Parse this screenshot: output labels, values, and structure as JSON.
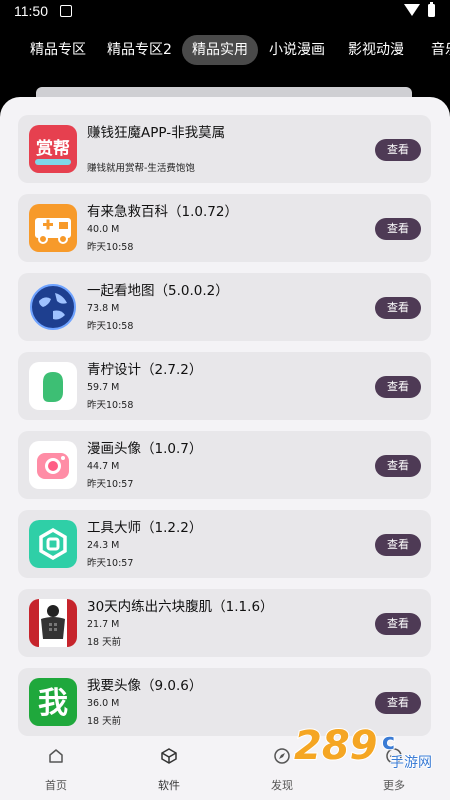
{
  "status_bar": {
    "time": "11:50"
  },
  "tabs": [
    "精品专区",
    "精品专区2",
    "精品实用",
    "小说漫画",
    "影视动漫",
    "音乐"
  ],
  "active_tab": 2,
  "apps": [
    {
      "name": "赚钱狂魔APP-非我莫属",
      "line1": "",
      "line2": "赚钱就用赏帮-生活费饱饱",
      "button": "查看",
      "icon": "shangbang-logo-icon"
    },
    {
      "name": "有来急救百科（1.0.72）",
      "line1": "40.0 M",
      "line2": "昨天10:58",
      "button": "查看",
      "icon": "ambulance-icon"
    },
    {
      "name": "一起看地图（5.0.0.2）",
      "line1": "73.8 M",
      "line2": "昨天10:58",
      "button": "查看",
      "icon": "globe-icon"
    },
    {
      "name": "青柠设计（2.7.2）",
      "line1": "59.7 M",
      "line2": "昨天10:58",
      "button": "查看",
      "icon": "lime-leaf-icon"
    },
    {
      "name": "漫画头像（1.0.7）",
      "line1": "44.7 M",
      "line2": "昨天10:57",
      "button": "查看",
      "icon": "camera-icon"
    },
    {
      "name": "工具大师（1.2.2）",
      "line1": "24.3 M",
      "line2": "昨天10:57",
      "button": "查看",
      "icon": "toolbox-hexagon-icon"
    },
    {
      "name": "30天内练出六块腹肌（1.1.6）",
      "line1": "21.7 M",
      "line2": "18 天前",
      "button": "查看",
      "icon": "fitness-man-icon"
    },
    {
      "name": "我要头像（9.0.6）",
      "line1": "36.0 M",
      "line2": "18 天前",
      "button": "查看",
      "icon": "wo-character-icon"
    }
  ],
  "bottom_nav": [
    {
      "label": "首页",
      "icon": "home-icon"
    },
    {
      "label": "软件",
      "icon": "software-cube-icon"
    },
    {
      "label": "发现",
      "icon": "compass-icon"
    },
    {
      "label": "更多",
      "icon": "more-icon"
    }
  ],
  "icon_shangbang_text": "赏帮",
  "icon_wo_text": "我",
  "watermark": {
    "text": "289",
    "suffix": "c",
    "sub": "手游网"
  },
  "colors": {
    "button_bg": "#4e3a55",
    "sheet_bg": "#f4f3f6",
    "card_bg": "#e8e7ea"
  }
}
